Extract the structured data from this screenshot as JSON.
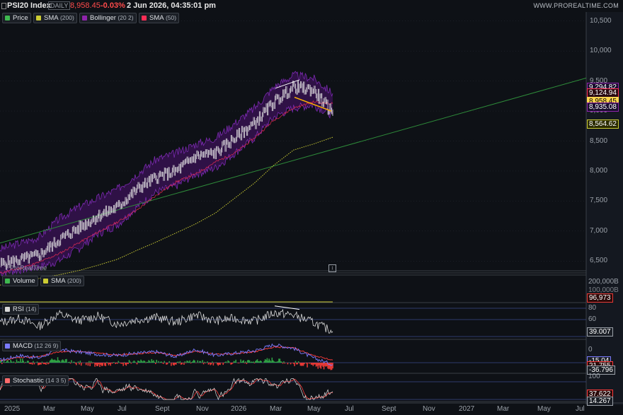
{
  "header": {
    "index": "PSI20 Index",
    "timeframe": "DAILY",
    "last": "8,958.45",
    "change": "-0.03%",
    "datetime": "2 Jun 2026, 04:35:01 pm",
    "source": "WWW.PROREALTIME.COM"
  },
  "logo": "ProRealTime",
  "colors": {
    "bg": "#0e1116",
    "price": "#ffffff",
    "bollinger": "#6a1b9a",
    "sma200": "#cccc33",
    "sma50": "#ff2d55",
    "trendline": "#2e8b3a",
    "volume_sma": "#cccc33",
    "macd": "#7a7aff",
    "signal": "#ff3b3b",
    "hist_up": "#2ea043",
    "hist_down": "#e53935",
    "rsi": "#d9d9d9",
    "grid": "#2a2f38"
  },
  "chart_data": [
    {
      "type": "line",
      "panel": "price",
      "legend": [
        {
          "name": "Price",
          "params": "",
          "color": "#3fb950",
          "icon": "candles-icon"
        },
        {
          "name": "SMA",
          "params": "(200)",
          "color": "#cccc33",
          "icon": "line-icon"
        },
        {
          "name": "Bollinger",
          "params": "(20 2)",
          "color": "#8e24aa",
          "icon": "band-icon"
        },
        {
          "name": "SMA",
          "params": "(50)",
          "color": "#ff2d55",
          "icon": "line-icon"
        }
      ],
      "y_ticks": [
        "10,500",
        "10,000",
        "9,500",
        "9,000",
        "8,500",
        "8,000",
        "7,500",
        "7,000",
        "6,500"
      ],
      "y_tick_values": [
        10500,
        10000,
        9500,
        9000,
        8500,
        8000,
        7500,
        7000,
        6500
      ],
      "ylim": [
        6350,
        10650
      ],
      "x": [
        "2025-01",
        "2025-02",
        "2025-03",
        "2025-04",
        "2025-05",
        "2025-06",
        "2025-07",
        "2025-08",
        "2025-09",
        "2025-10",
        "2025-11",
        "2025-12",
        "2026-01",
        "2026-02",
        "2026-03",
        "2026-04",
        "2026-05",
        "2026-06"
      ],
      "series": [
        {
          "name": "Price",
          "values": [
            6450,
            6520,
            6600,
            6850,
            7050,
            7250,
            7400,
            7700,
            7900,
            8000,
            8250,
            8300,
            8550,
            8800,
            9150,
            9400,
            9350,
            8958
          ]
        },
        {
          "name": "SMA",
          "values": [
            6100,
            6150,
            6210,
            6270,
            6340,
            6430,
            6530,
            6680,
            6820,
            6970,
            7120,
            7300,
            7550,
            7800,
            8100,
            8350,
            8450,
            8564
          ]
        },
        {
          "name": "SMA",
          "values": [
            6300,
            6380,
            6480,
            6620,
            6800,
            6980,
            7150,
            7350,
            7600,
            7820,
            7950,
            8150,
            8300,
            8550,
            8850,
            9050,
            9150,
            9124
          ]
        }
      ],
      "bollinger_upper": [
        6700,
        6800,
        6900,
        7200,
        7400,
        7550,
        7700,
        7950,
        8200,
        8300,
        8450,
        8550,
        8800,
        9050,
        9400,
        9600,
        9550,
        9294
      ],
      "bollinger_lower": [
        6300,
        6350,
        6400,
        6500,
        6700,
        6950,
        7100,
        7400,
        7650,
        7750,
        7950,
        8050,
        8300,
        8550,
        8900,
        9050,
        9100,
        8930
      ],
      "trendline_values": {
        "start": 6800,
        "end": 9550
      },
      "value_tags": [
        {
          "text": "9,294.82",
          "bg": "#1a0f2e",
          "fg": "#ffffff",
          "border": "#8e24aa",
          "value": 9294.82
        },
        {
          "text": "9,124.94",
          "bg": "#2a0a12",
          "fg": "#ffffff",
          "border": "#ff2d55",
          "value": 9124.94
        },
        {
          "text": "8,958.45",
          "bg": "#ffd54f",
          "fg": "#000000",
          "border": "#ffd54f",
          "value": 8958.45
        },
        {
          "text": "8,935.08",
          "bg": "#1a0f2e",
          "fg": "#ffffff",
          "border": "#8e24aa",
          "value": 8935.08
        },
        {
          "text": "8,564.62",
          "bg": "#2a2a00",
          "fg": "#ffffff",
          "border": "#cccc33",
          "value": 8564.62
        }
      ]
    },
    {
      "type": "bar",
      "panel": "volume",
      "legend": [
        {
          "name": "Volume",
          "params": "",
          "color": "#3fb950",
          "icon": "bars-icon"
        },
        {
          "name": "SMA",
          "params": "(200)",
          "color": "#cccc33",
          "icon": "line-icon"
        }
      ],
      "y_ticks": [
        "200,000B",
        "100,000B"
      ],
      "value_tags": [
        {
          "text": "96,973",
          "bg": "#2a0a0a",
          "fg": "#ffffff",
          "border": "#e53935"
        }
      ]
    },
    {
      "type": "line",
      "panel": "rsi",
      "legend": [
        {
          "name": "RSI",
          "params": "(14)",
          "color": "#d9d9d9",
          "icon": "line-icon"
        }
      ],
      "y_ticks": [
        "80",
        "60"
      ],
      "ylim": [
        25,
        90
      ],
      "series": [
        {
          "name": "RSI",
          "values": [
            55,
            62,
            48,
            70,
            58,
            66,
            52,
            60,
            64,
            55,
            68,
            58,
            62,
            57,
            72,
            68,
            55,
            39.007
          ]
        }
      ],
      "value_tags": [
        {
          "text": "39.007",
          "bg": "#1b1f26",
          "fg": "#ffffff",
          "border": "#9aa0a8"
        }
      ]
    },
    {
      "type": "line",
      "panel": "macd",
      "legend": [
        {
          "name": "MACD",
          "params": "(12 26 9)",
          "color": "#7a7aff",
          "icon": "line-icon"
        }
      ],
      "y_ticks": [
        "0"
      ],
      "series": [
        {
          "name": "MACD",
          "values": [
            20,
            60,
            40,
            110,
            90,
            70,
            60,
            80,
            90,
            50,
            110,
            60,
            80,
            100,
            150,
            120,
            40,
            -15.04
          ]
        },
        {
          "name": "Signal",
          "values": [
            15,
            45,
            50,
            90,
            95,
            80,
            65,
            75,
            85,
            60,
            95,
            70,
            75,
            90,
            130,
            125,
            60,
            21.755
          ]
        }
      ],
      "value_tags": [
        {
          "text": "-15.04",
          "bg": "#1b1f26",
          "fg": "#ffffff",
          "border": "#7a7aff"
        },
        {
          "text": "21.755",
          "bg": "#2a0a0a",
          "fg": "#ffffff",
          "border": "#ff3b3b"
        },
        {
          "text": "-36.796",
          "bg": "#1b1f26",
          "fg": "#ffffff",
          "border": "#9aa0a8"
        }
      ]
    },
    {
      "type": "line",
      "panel": "stochastic",
      "legend": [
        {
          "name": "Stochastic",
          "params": "(14 3 5)",
          "color": "#ff6b6b",
          "icon": "line-icon"
        }
      ],
      "y_ticks": [
        "100"
      ],
      "ylim": [
        0,
        100
      ],
      "value_tags": [
        {
          "text": "37.622",
          "bg": "#2a0a0a",
          "fg": "#ffffff",
          "border": "#ff3b3b"
        },
        {
          "text": "14.267",
          "bg": "#1b1f26",
          "fg": "#ffffff",
          "border": "#9aa0a8"
        }
      ]
    }
  ],
  "x_axis_labels": [
    "2025",
    "Mar",
    "May",
    "Jul",
    "Sept",
    "Nov",
    "2026",
    "Mar",
    "May",
    "Jul",
    "Sept",
    "Nov",
    "2027",
    "Mar",
    "May",
    "Jul"
  ]
}
